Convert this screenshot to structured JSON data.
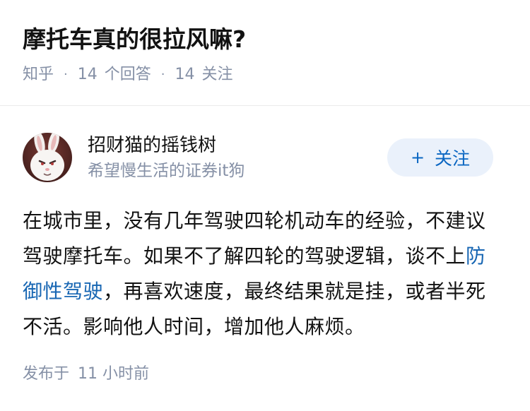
{
  "question": {
    "title": "摩托车真的很拉风嘛?",
    "source": "知乎",
    "answers_count": "14",
    "answers_label": "个回答",
    "followers_count": "14",
    "followers_label": "关注"
  },
  "answer": {
    "author": {
      "name": "招财猫的摇钱树",
      "bio": "希望慢生活的证券it狗",
      "avatar_icon": "white-rabbit-avatar"
    },
    "follow_button": {
      "icon": "+",
      "label": "关注"
    },
    "content": {
      "part1": "在城市里，没有几年驾驶四轮机动车的经验，不建议驾驶摩托车。如果不了解四轮的驾驶逻辑，谈不上",
      "link": "防御性驾驶",
      "part2": "，再喜欢速度，最终结果就是挂，或者半死不活。影响他人时间，增加他人麻烦。"
    },
    "footer": {
      "published_label": "发布于",
      "time": "11 小时前"
    }
  },
  "colors": {
    "meta": "#8590a6",
    "link": "#1766b3",
    "follow_bg": "#eaf1fb",
    "follow_text": "#0a66c2"
  }
}
